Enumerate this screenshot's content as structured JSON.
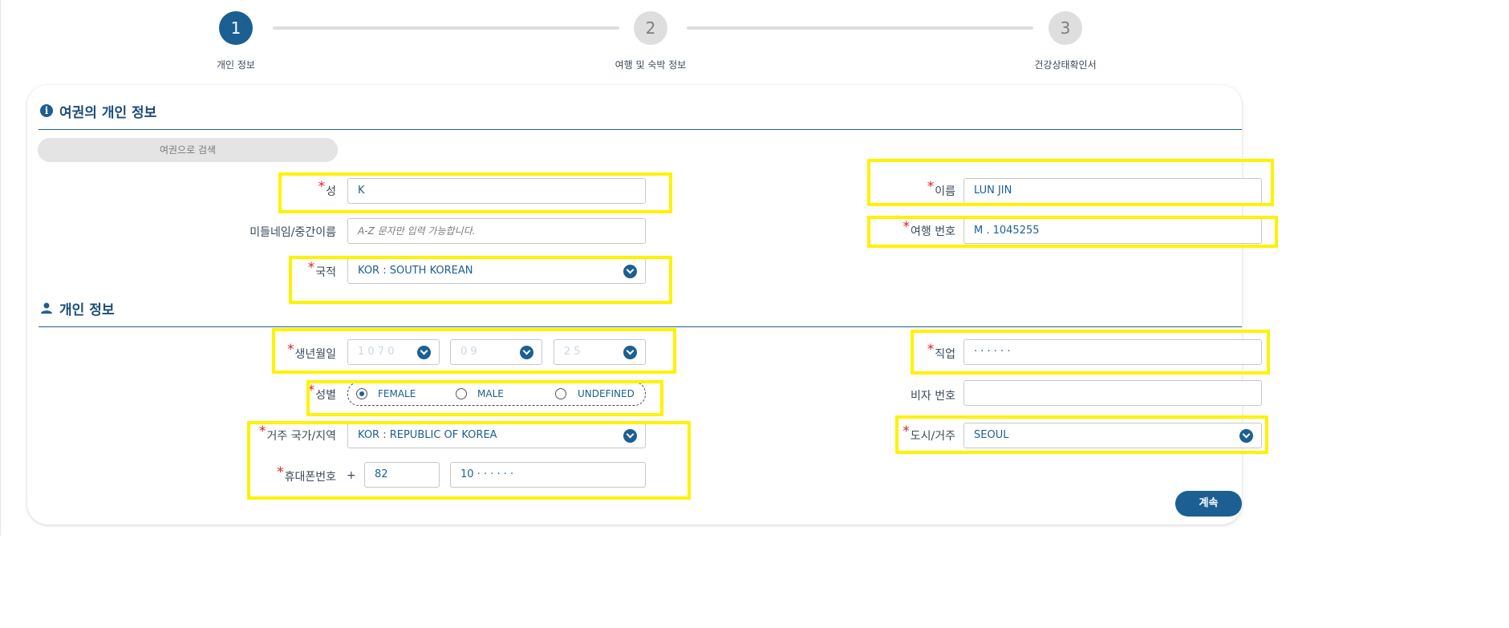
{
  "stepper": {
    "steps": [
      {
        "number": "1",
        "label": "개인 정보"
      },
      {
        "number": "2",
        "label": "여행 및 숙박 정보"
      },
      {
        "number": "3",
        "label": "건강상태확인서"
      }
    ]
  },
  "passport_section": {
    "title": "여권의 개인 정보",
    "search_button": "여권으로 검색",
    "surname": {
      "label": "성",
      "value": "K"
    },
    "given_name": {
      "label": "이름",
      "value": "LUN JIN"
    },
    "middle_name": {
      "label": "미들네임/중간이름",
      "placeholder": "A-Z 문자만 입력 가능합니다."
    },
    "travel_number": {
      "label": "여행 번호",
      "value": "M . 1045255"
    },
    "nationality": {
      "label": "국적",
      "value": "KOR : SOUTH KOREAN"
    }
  },
  "personal_section": {
    "title": "개인 정보",
    "birth_date": {
      "label": "생년월일",
      "year": "1 0 7 0",
      "month": "0 9",
      "day": "2 5"
    },
    "occupation": {
      "label": "직업",
      "value": "· · · · · ·"
    },
    "gender": {
      "label": "성별",
      "options": [
        "FEMALE",
        "MALE",
        "UNDEFINED"
      ],
      "selected": "FEMALE"
    },
    "visa_number": {
      "label": "비자 번호",
      "value": ""
    },
    "residence_country": {
      "label": "거주 국가/지역",
      "value": "KOR : REPUBLIC OF KOREA"
    },
    "city": {
      "label": "도시/거주",
      "value": "SEOUL"
    },
    "phone": {
      "label": "휴대폰번호",
      "plus": "+",
      "country_code": "82",
      "number": "10 · · · · · ·"
    }
  },
  "continue_button": "계속",
  "colors": {
    "primary": "#1c5f92",
    "highlight": "#fff200",
    "required": "#e02020"
  }
}
